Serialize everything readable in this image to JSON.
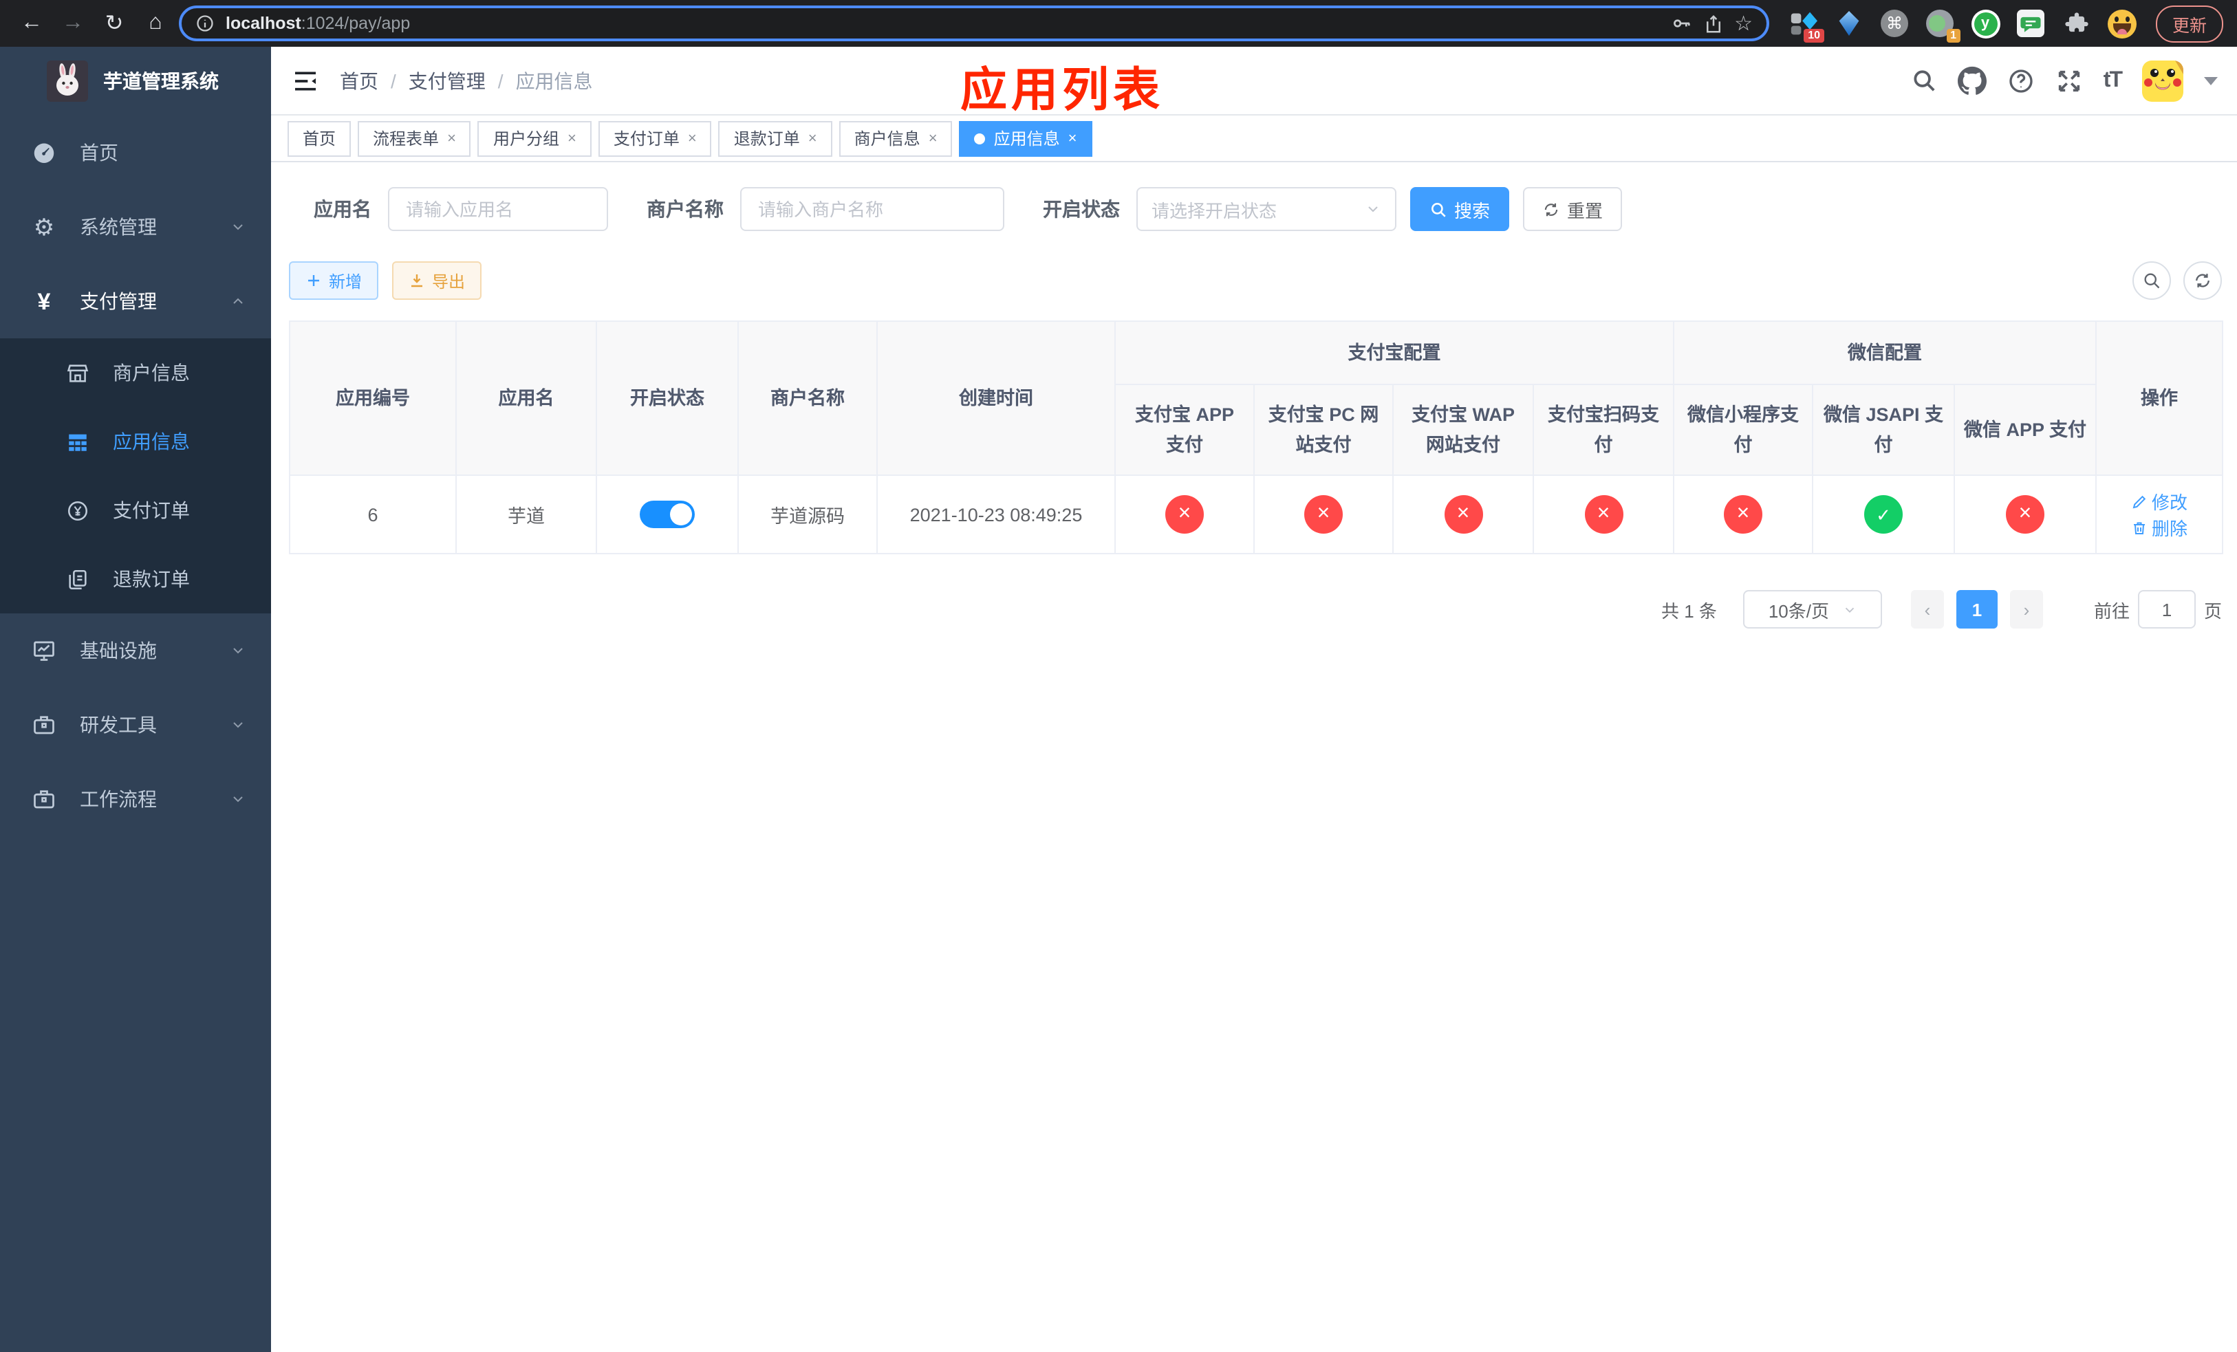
{
  "glyphs": {
    "back": "←",
    "forward": "→",
    "reload": "↻",
    "home": "⌂",
    "star": "☆",
    "command": "⌘",
    "dots": "⋮",
    "gear": "⚙",
    "yen": "¥",
    "font_size": "tT",
    "close": "×",
    "prev": "‹",
    "next": "›"
  },
  "browser": {
    "url_host": "localhost",
    "url_rest": ":1024/pay/app",
    "update_label": "更新",
    "ext_badge_a": "10",
    "ext_badge_b": "1",
    "ext_y_label": "y"
  },
  "app_title": "芋道管理系统",
  "sidebar": {
    "items": [
      {
        "label": "首页"
      },
      {
        "label": "系统管理"
      },
      {
        "label": "支付管理"
      },
      {
        "label": "商户信息"
      },
      {
        "label": "应用信息"
      },
      {
        "label": "支付订单"
      },
      {
        "label": "退款订单"
      },
      {
        "label": "基础设施"
      },
      {
        "label": "研发工具"
      },
      {
        "label": "工作流程"
      }
    ]
  },
  "breadcrumb": {
    "separator": "/",
    "items": [
      "首页",
      "支付管理",
      "应用信息"
    ]
  },
  "overlay": {
    "title": "应用列表"
  },
  "tabs": [
    {
      "label": "首页"
    },
    {
      "label": "流程表单"
    },
    {
      "label": "用户分组"
    },
    {
      "label": "支付订单"
    },
    {
      "label": "退款订单"
    },
    {
      "label": "商户信息"
    },
    {
      "label": "应用信息"
    }
  ],
  "filters": {
    "app_name_label": "应用名",
    "app_name_placeholder": "请输入应用名",
    "merchant_label": "商户名称",
    "merchant_placeholder": "请输入商户名称",
    "status_label": "开启状态",
    "status_placeholder": "请选择开启状态",
    "search_label": "搜索",
    "reset_label": "重置"
  },
  "toolbar": {
    "add_label": "新增",
    "export_label": "导出"
  },
  "table": {
    "group_alipay": "支付宝配置",
    "group_wechat": "微信配置",
    "col_app_id": "应用编号",
    "col_app_name": "应用名",
    "col_status": "开启状态",
    "col_merchant": "商户名称",
    "col_created": "创建时间",
    "col_alipay_app": "支付宝 APP 支付",
    "col_alipay_pc": "支付宝 PC 网站支付",
    "col_alipay_wap": "支付宝 WAP 网站支付",
    "col_alipay_qr": "支付宝扫码支付",
    "col_wx_mini": "微信小程序支付",
    "col_wx_jsapi": "微信 JSAPI 支付",
    "col_wx_app": "微信 APP 支付",
    "col_ops": "操作",
    "row": {
      "app_id": "6",
      "app_name": "芋道",
      "switch": "on",
      "merchant": "芋道源码",
      "created": "2021-10-23 08:49:25",
      "channels": [
        "disabled",
        "disabled",
        "disabled",
        "disabled",
        "disabled",
        "enabled",
        "disabled"
      ],
      "edit_label": "修改",
      "delete_label": "删除"
    }
  },
  "pagination": {
    "total": "共 1 条",
    "page_size": "10条/页",
    "page": "1",
    "goto_label": "前往",
    "goto_value": "1",
    "page_unit": "页"
  },
  "colors": {
    "accent": "#409eff",
    "danger": "#ff4949",
    "success": "#13ce66",
    "warning": "#e6a23c",
    "overlay_red": "#ff2600",
    "sidebar_bg": "#304156",
    "submenu_bg": "#1f2d3d"
  }
}
